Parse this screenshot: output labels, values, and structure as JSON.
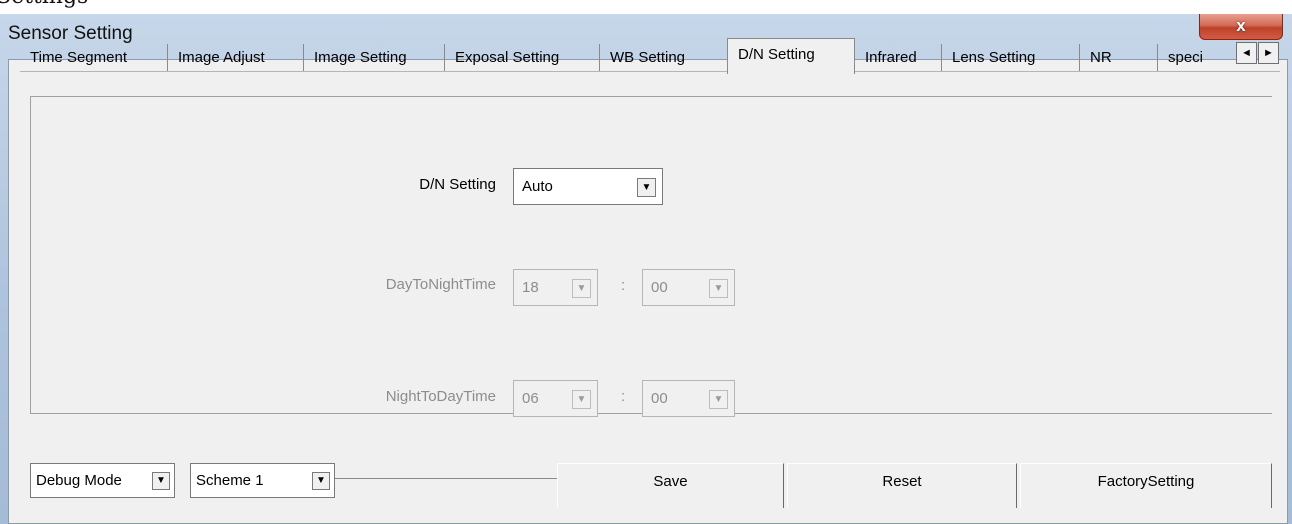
{
  "window": {
    "outer_title": "Settings",
    "title": "Sensor Setting",
    "close_label": "x"
  },
  "tabs": [
    {
      "label": "Time Segment"
    },
    {
      "label": "Image Adjust"
    },
    {
      "label": "Image Setting"
    },
    {
      "label": "Exposal Setting"
    },
    {
      "label": "WB Setting"
    },
    {
      "label": "D/N Setting",
      "active": true
    },
    {
      "label": "Infrared"
    },
    {
      "label": "Lens Setting"
    },
    {
      "label": "NR"
    },
    {
      "label": "speci"
    }
  ],
  "tab_scroll": {
    "left": "◄",
    "right": "►"
  },
  "dn_setting": {
    "label": "D/N Setting",
    "value": "Auto",
    "arrow": "▼"
  },
  "day_to_night": {
    "label": "DayToNightTime",
    "hour": "18",
    "colon": ":",
    "minute": "00",
    "arrow": "▼"
  },
  "night_to_day": {
    "label": "NightToDayTime",
    "hour": "06",
    "colon": ":",
    "minute": "00",
    "arrow": "▼"
  },
  "bottom": {
    "mode": "Debug Mode",
    "scheme": "Scheme 1",
    "arrow": "▼",
    "save": "Save",
    "reset": "Reset",
    "factory": "FactorySetting"
  }
}
